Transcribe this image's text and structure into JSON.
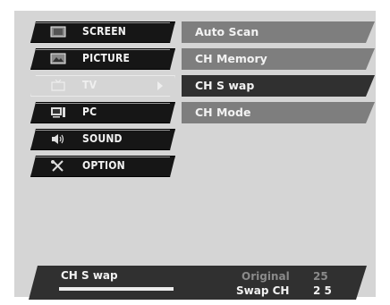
{
  "menu": {
    "items": [
      {
        "label": "SCREEN",
        "icon": "screen-icon"
      },
      {
        "label": "PICTURE",
        "icon": "picture-icon"
      },
      {
        "label": "TV",
        "icon": "tv-icon",
        "selected": true
      },
      {
        "label": "PC",
        "icon": "pc-icon"
      },
      {
        "label": "SOUND",
        "icon": "sound-icon"
      },
      {
        "label": "OPTION",
        "icon": "option-icon"
      }
    ]
  },
  "submenu": {
    "items": [
      {
        "label": "Auto Scan"
      },
      {
        "label": "CH Memory"
      },
      {
        "label": "CH S wap",
        "active": true
      },
      {
        "label": "CH Mode"
      }
    ]
  },
  "status": {
    "title": "CH S wap",
    "original_label": "Original",
    "original_value": "25",
    "swap_label": "Swap CH",
    "swap_value": "2 5"
  },
  "colors": {
    "panel": "#d5d5d5",
    "menu_item": "#161616",
    "submenu_item": "#7e7e7e",
    "submenu_active": "#303030",
    "status_bar": "#303030"
  }
}
